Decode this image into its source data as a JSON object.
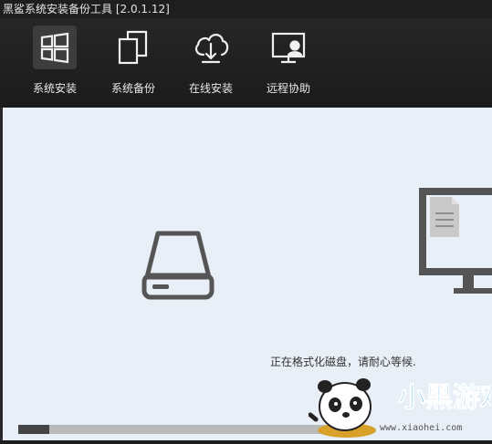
{
  "window": {
    "title": "黑鲨系统安装备份工具 [2.0.1.12]"
  },
  "toolbar": {
    "items": [
      {
        "label": "系统安装",
        "icon": "windows-icon",
        "active": true
      },
      {
        "label": "系统备份",
        "icon": "copy-icon",
        "active": false
      },
      {
        "label": "在线安装",
        "icon": "cloud-download-icon",
        "active": false
      },
      {
        "label": "远程协助",
        "icon": "remote-support-icon",
        "active": false
      }
    ]
  },
  "main": {
    "status_text": "正在格式化磁盘，请耐心等候.",
    "progress": 0.09,
    "source_icon": "hard-drive-icon",
    "target_icon": "monitor-document-icon"
  },
  "watermark": {
    "text": "小黑游戏",
    "url": "www.xiaohei.com"
  },
  "colors": {
    "toolbar_bg": "#1e1e1e",
    "content_bg": "#e8eff6",
    "icon_gray": "#555555",
    "progress_fill": "#444444",
    "progress_track": "#b9b9b9"
  }
}
